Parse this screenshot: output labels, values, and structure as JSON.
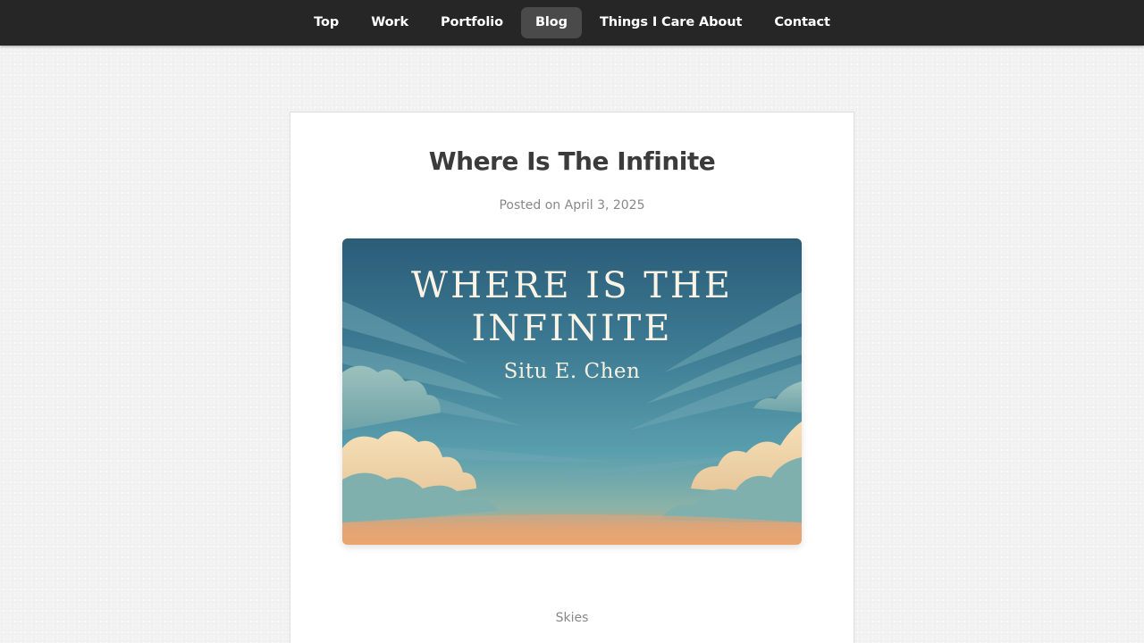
{
  "nav": {
    "items": [
      {
        "label": "Top",
        "active": false
      },
      {
        "label": "Work",
        "active": false
      },
      {
        "label": "Portfolio",
        "active": false
      },
      {
        "label": "Blog",
        "active": true
      },
      {
        "label": "Things I Care About",
        "active": false
      },
      {
        "label": "Contact",
        "active": false
      }
    ]
  },
  "post": {
    "title": "Where Is The Infinite",
    "meta": "Posted on April 3, 2025",
    "cover": {
      "title_line1": "WHERE IS THE",
      "title_line2": "INFINITE",
      "author": "Situ E. Chen"
    },
    "category": "Skies"
  },
  "colors": {
    "nav_bg": "#262626",
    "nav_active_bg": "#4a4a4a",
    "title": "#3b3b3b",
    "meta": "#888888"
  }
}
